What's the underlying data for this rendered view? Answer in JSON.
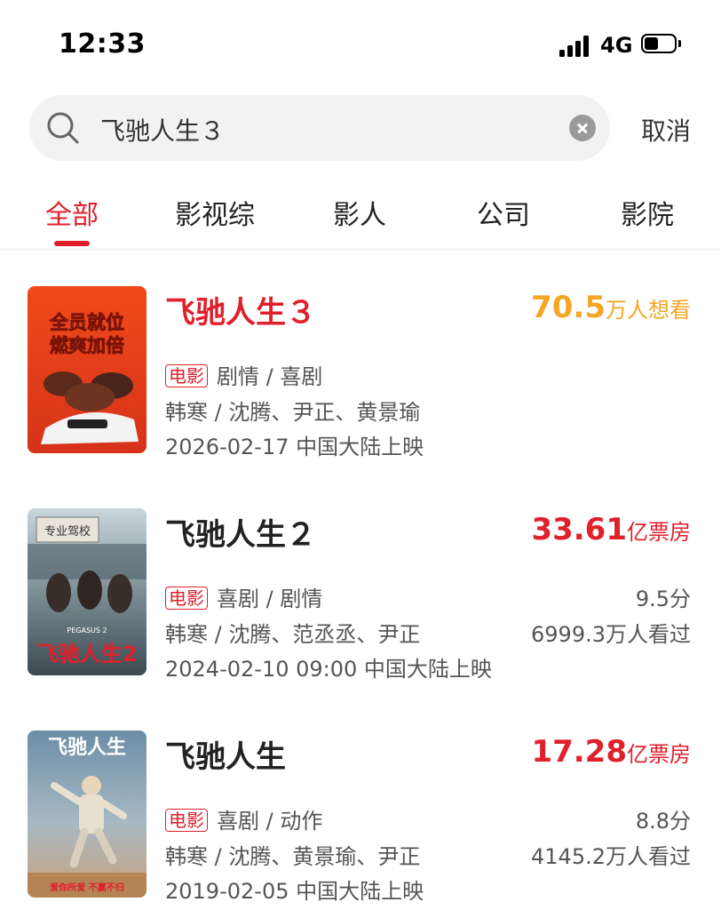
{
  "status_bar": {
    "time": "12:33",
    "network": "4G"
  },
  "search": {
    "query": "飞驰人生３",
    "cancel_label": "取消"
  },
  "tabs": [
    "全部",
    "影视综",
    "影人",
    "公司",
    "影院"
  ],
  "movies": [
    {
      "title": "飞驰人生３",
      "stat_value": "70.5",
      "stat_unit": "万人想看",
      "type_badge": "电影",
      "genres": "剧情 / 喜剧",
      "cast": "韩寒 / 沈腾、尹正、黄景瑜",
      "release": "2026-02-17 中国大陆上映",
      "poster_text": [
        "全员就位",
        "燃爽加倍"
      ]
    },
    {
      "title": "飞驰人生２",
      "stat_value": "33.61",
      "stat_unit": "亿票房",
      "type_badge": "电影",
      "genres": "喜剧 / 剧情",
      "cast": "韩寒 / 沈腾、范丞丞、尹正",
      "release": "2024-02-10 09:00 中国大陆上映",
      "rating": "9.5分",
      "watched": "6999.3万人看过",
      "poster_text": [
        "专业驾校",
        "PEGASUS 2",
        "飞驰人生2"
      ]
    },
    {
      "title": "飞驰人生",
      "stat_value": "17.28",
      "stat_unit": "亿票房",
      "type_badge": "电影",
      "genres": "喜剧 / 动作",
      "cast": "韩寒 / 沈腾、黄景瑜、尹正",
      "release": "2019-02-05 中国大陆上映",
      "rating": "8.8分",
      "watched": "4145.2万人看过",
      "poster_text": [
        "飞驰人生",
        "爱你所爱 不赢不归"
      ]
    }
  ],
  "colors": {
    "accent": "#e0202b",
    "want_to_see": "#f5a623",
    "search_bg": "#f2f2f2"
  },
  "icons": {
    "search": "search-icon",
    "clear": "clear-icon",
    "signal": "signal-icon",
    "battery": "battery-icon"
  }
}
